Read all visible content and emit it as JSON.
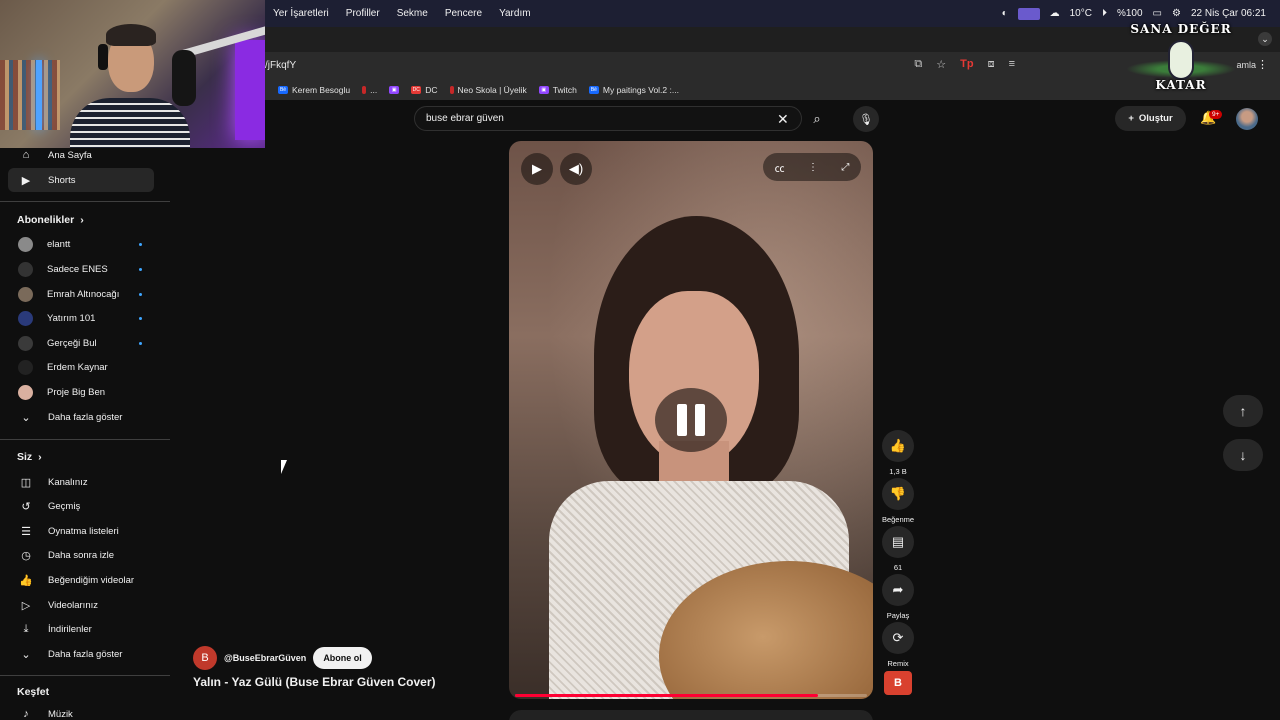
{
  "menubar": {
    "items": [
      "Yer İşaretleri",
      "Profiller",
      "Sekme",
      "Pencere",
      "Yardım"
    ],
    "temperature": "10°C",
    "battery": "%100",
    "datetime": "22 Nis Çar  06:21"
  },
  "browser": {
    "url": "/jFkqfY",
    "profile_label": "amla",
    "bookmarks": [
      {
        "label": "Kerem Besoglu",
        "icon": "behance-icon"
      },
      {
        "label": "...",
        "icon": "red-icon"
      },
      {
        "label": "",
        "icon": "twitch-icon"
      },
      {
        "label": "DC",
        "icon": "dc-icon"
      },
      {
        "label": "Neo Skola | Üyelik",
        "icon": "red-icon"
      },
      {
        "label": "Twitch",
        "icon": "twitch-icon"
      },
      {
        "label": "My paitings Vol.2 :...",
        "icon": "behance-icon"
      }
    ]
  },
  "badge": {
    "top": "SANA DEĞER",
    "bottom": "KATAR"
  },
  "search": {
    "value": "buse ebrar güven"
  },
  "header": {
    "create_label": "Oluştur",
    "notif_count": "9+"
  },
  "sidebar": {
    "home": "Ana Sayfa",
    "shorts": "Shorts",
    "subscriptions_title": "Abonelikler",
    "subscriptions": [
      {
        "name": "elantt",
        "color": "#8a8a8a",
        "dot": true
      },
      {
        "name": "Sadece ENES",
        "color": "#333333",
        "dot": true
      },
      {
        "name": "Emrah Altınocağı",
        "color": "#7a6a5a",
        "dot": true
      },
      {
        "name": "Yatırım 101",
        "color": "#2a3a7a",
        "dot": true
      },
      {
        "name": "Gerçeği Bul",
        "color": "#3a3a3a",
        "dot": true
      },
      {
        "name": "Erdem Kaynar",
        "color": "#222222",
        "dot": false
      },
      {
        "name": "Proje Big Ben",
        "color": "#d9b0a0",
        "dot": false
      }
    ],
    "show_more": "Daha fazla göster",
    "you_title": "Siz",
    "you_items": [
      {
        "label": "Kanalınız",
        "icon": "account-icon"
      },
      {
        "label": "Geçmiş",
        "icon": "history-icon"
      },
      {
        "label": "Oynatma listeleri",
        "icon": "playlist-icon"
      },
      {
        "label": "Daha sonra izle",
        "icon": "clock-icon"
      },
      {
        "label": "Beğendiğim videolar",
        "icon": "thumb-up-icon"
      },
      {
        "label": "Videolarınız",
        "icon": "video-icon"
      },
      {
        "label": "İndirilenler",
        "icon": "download-icon"
      }
    ],
    "you_show_more": "Daha fazla göster",
    "explore_title": "Keşfet",
    "explore_first": "Müzik"
  },
  "video": {
    "channel_handle": "@BuseEbrarGüven",
    "channel_initial": "B",
    "subscribe_label": "Abone ol",
    "title": "Yalın - Yaz Gülü (Buse Ebrar Güven Cover)",
    "progress": 0.86
  },
  "actions": {
    "like_count": "1,3 B",
    "dislike_label": "Beğenme",
    "comment_count": "61",
    "share_label": "Paylaş",
    "remix_label": "Remix"
  }
}
